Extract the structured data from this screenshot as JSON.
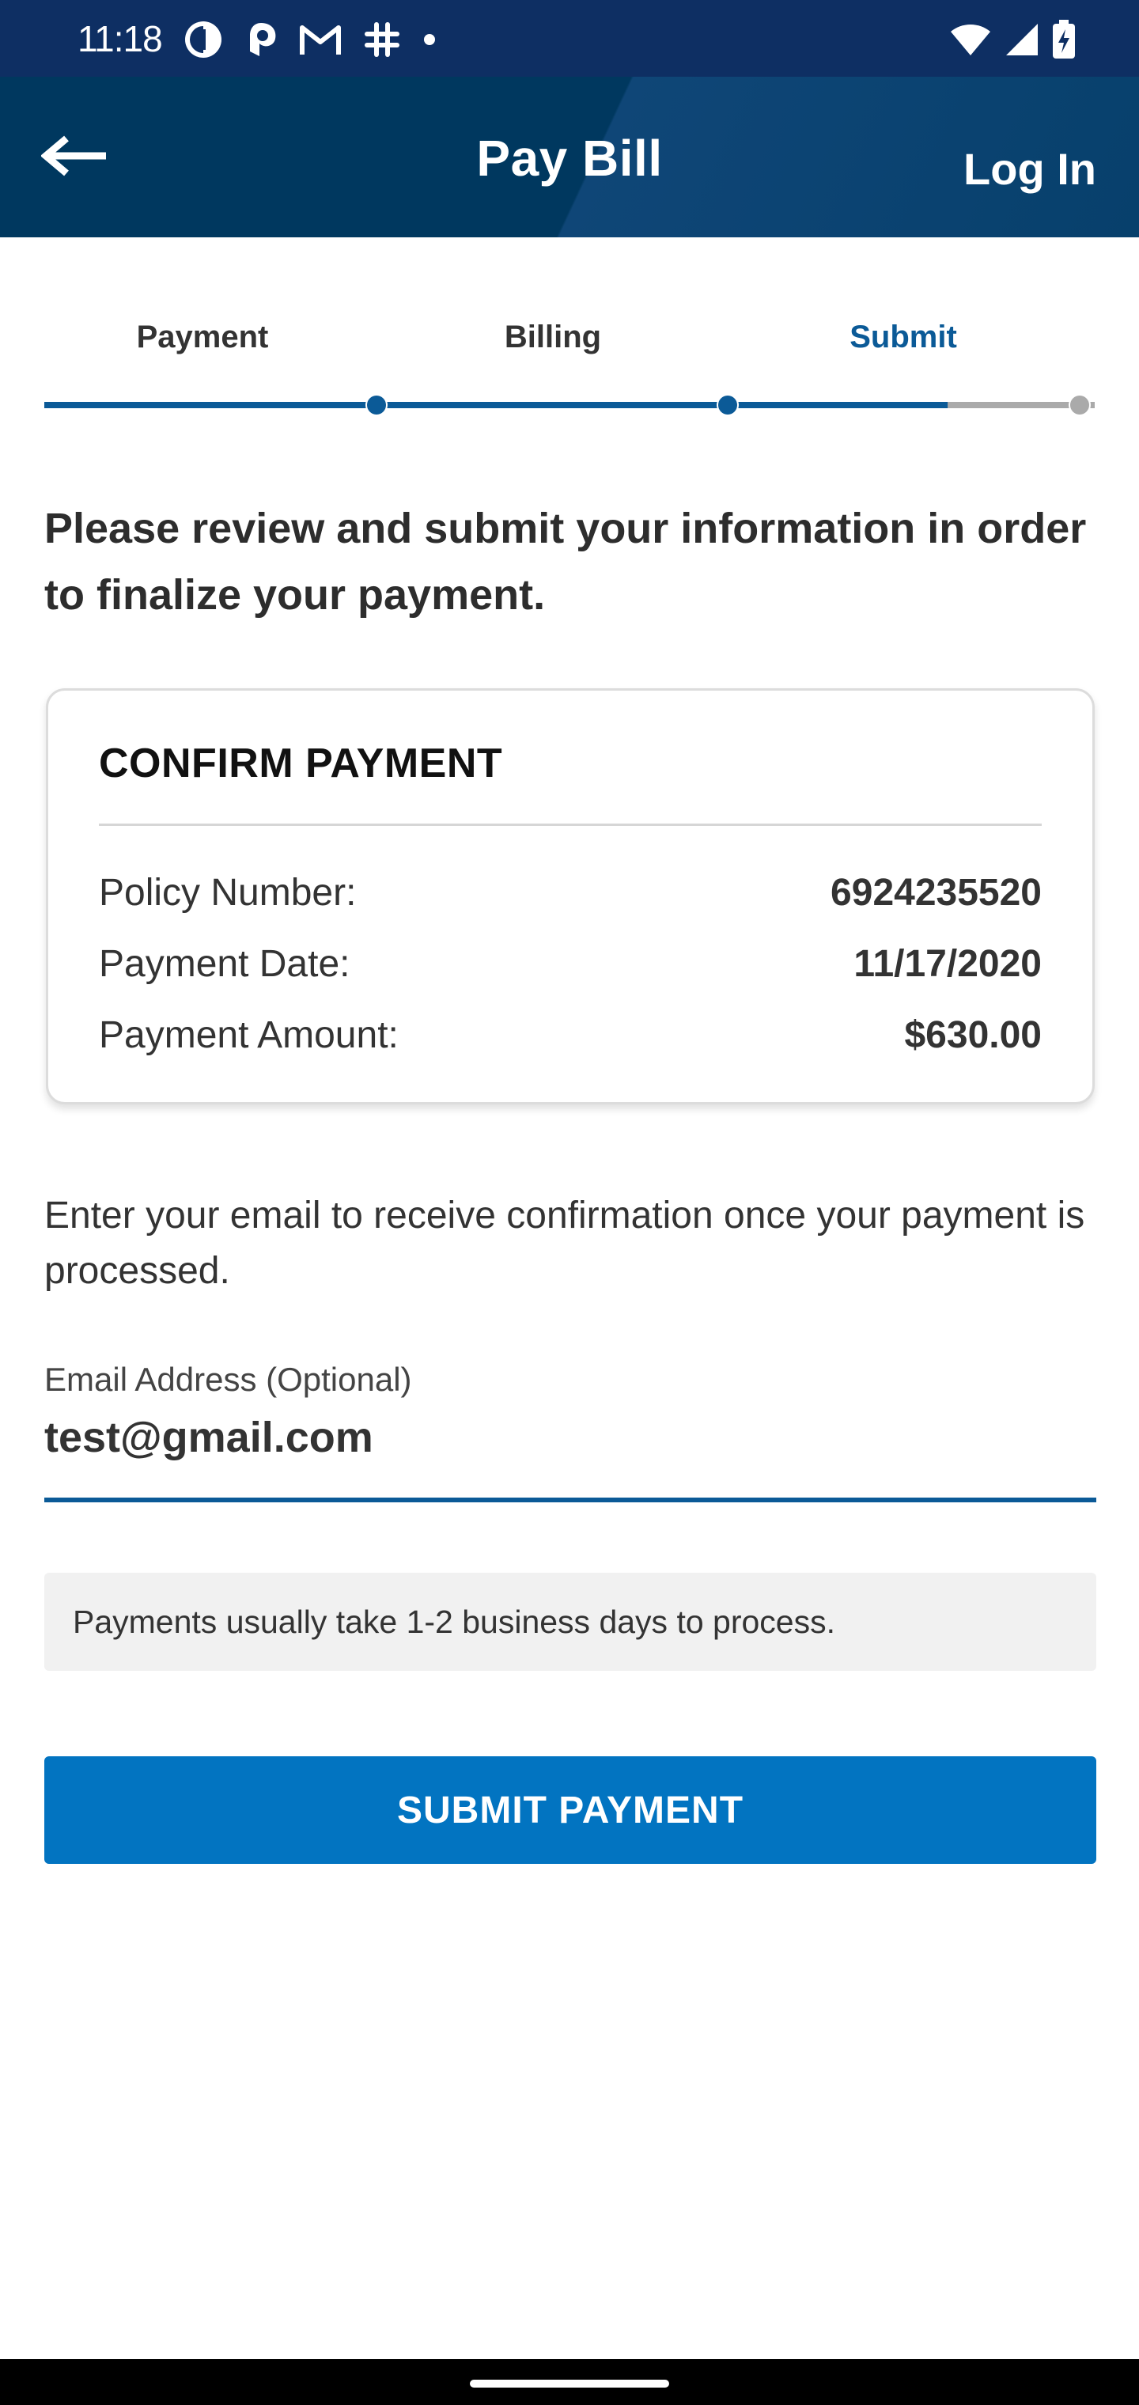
{
  "status_bar": {
    "time": "11:18",
    "app_icons": [
      "sync-app-icon",
      "pinwheel-app-icon",
      "gmail-icon",
      "slack-icon",
      "dot-icon"
    ],
    "system_icons": [
      "wifi-icon",
      "cellular-signal-icon",
      "battery-charging-icon"
    ]
  },
  "app_bar": {
    "title": "Pay Bill",
    "login_label": "Log In",
    "back_icon": "arrow-left-icon"
  },
  "steps": {
    "items": [
      "Payment",
      "Billing",
      "Submit"
    ],
    "active_index": 2,
    "progress_fraction": 0.86
  },
  "intro_text": "Please review and submit your information in order to finalize your payment.",
  "confirm": {
    "title": "CONFIRM PAYMENT",
    "rows": [
      {
        "label": "Policy Number:",
        "value": "6924235520"
      },
      {
        "label": "Payment Date:",
        "value": "11/17/2020"
      },
      {
        "label": "Payment Amount:",
        "value": "$630.00"
      }
    ]
  },
  "email": {
    "description": "Enter your email to receive confirmation once your payment is processed.",
    "label": "Email Address (Optional)",
    "value": "test@gmail.com"
  },
  "notice": "Payments usually take 1-2 business days to process.",
  "submit_label": "SUBMIT PAYMENT",
  "colors": {
    "status_bar": "#0e2f63",
    "app_bar": "#00385f",
    "accent": "#0b5a97",
    "button": "#0274c1",
    "track_inactive": "#aaaaaa"
  }
}
